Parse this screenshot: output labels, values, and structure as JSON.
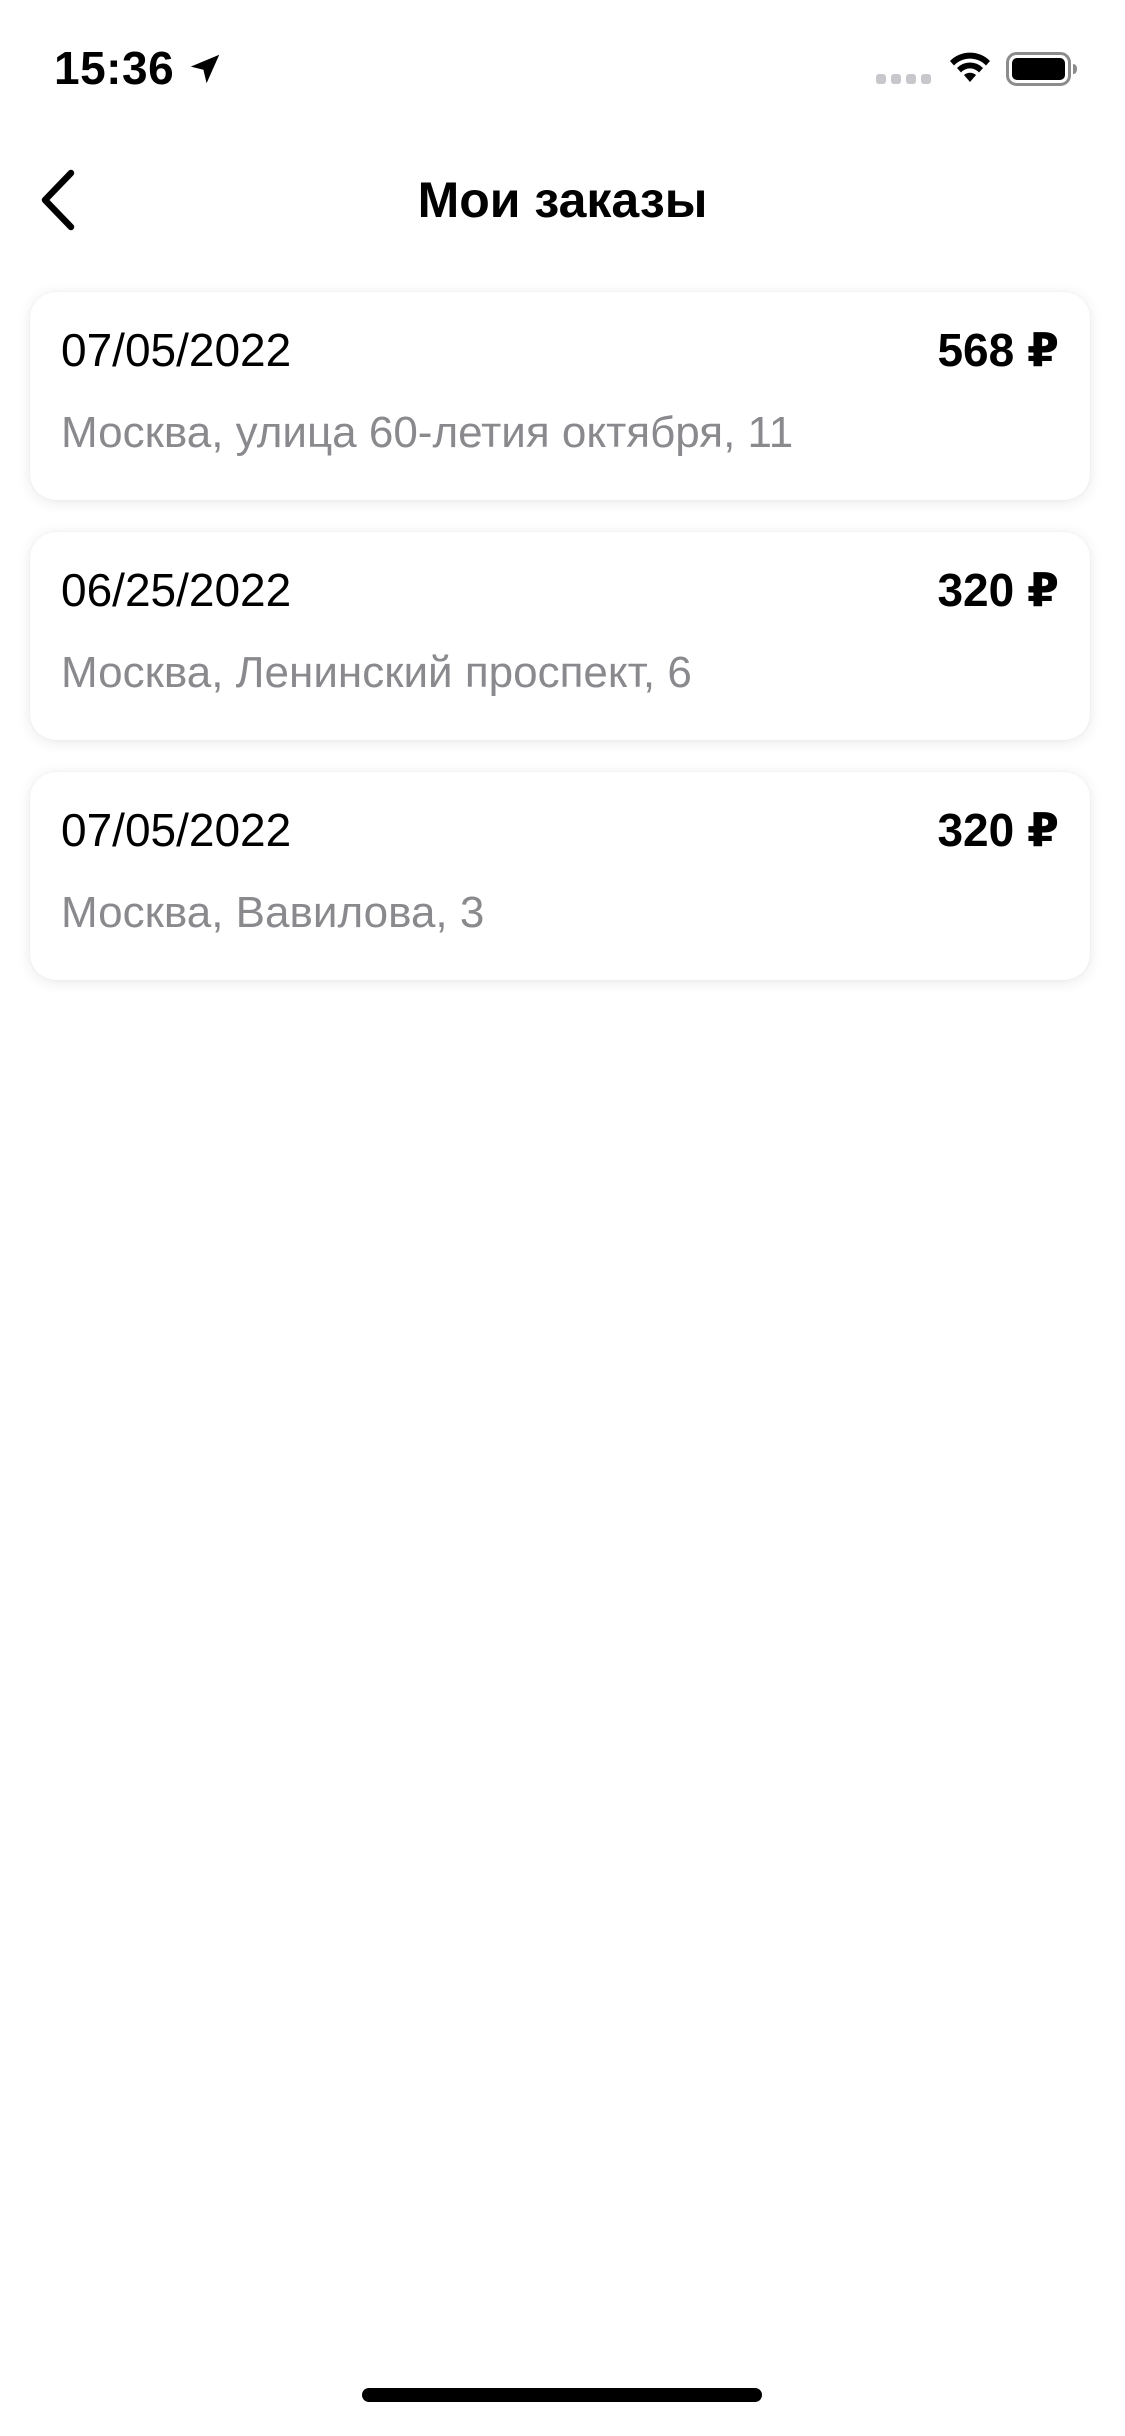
{
  "status_bar": {
    "time": "15:36",
    "icons": [
      "location-arrow-icon",
      "signal-dots-icon",
      "wifi-icon",
      "battery-icon"
    ]
  },
  "nav": {
    "back_icon": "chevron-left-icon",
    "title": "Мои заказы"
  },
  "orders": [
    {
      "date": "07/05/2022",
      "price": "568 ₽",
      "address": "Москва, улица 60-летия октября, 11"
    },
    {
      "date": "06/25/2022",
      "price": "320 ₽",
      "address": "Москва, Ленинский проспект, 6"
    },
    {
      "date": "07/05/2022",
      "price": "320 ₽",
      "address": "Москва, Вавилова, 3"
    }
  ],
  "colors": {
    "text_primary": "#000000",
    "text_secondary": "#8a8a8e",
    "background": "#ffffff"
  }
}
